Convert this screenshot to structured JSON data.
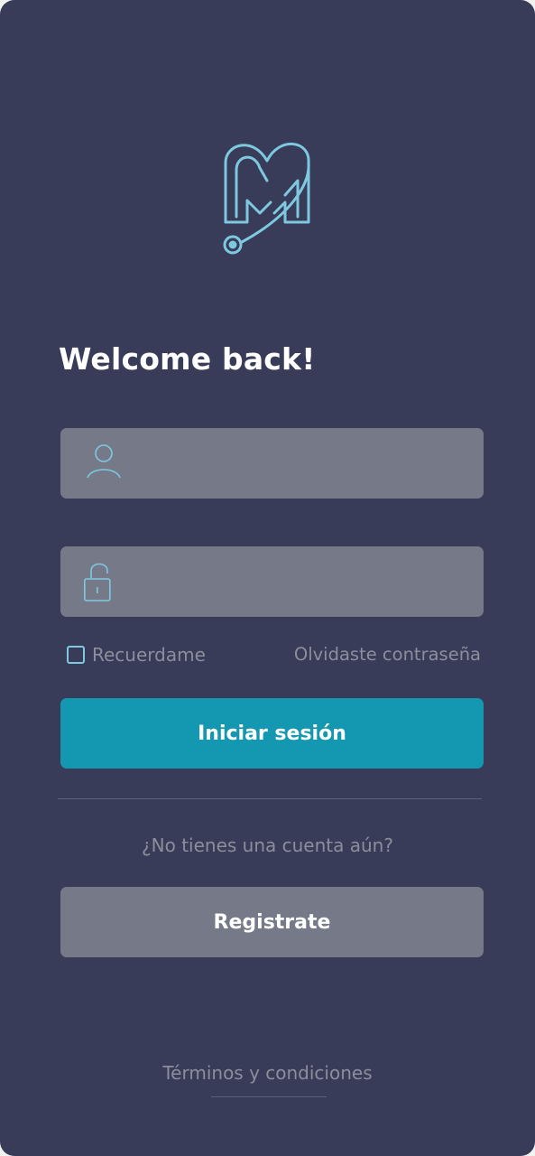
{
  "welcome_title": "Welcome back!",
  "username_field": {
    "value": "",
    "placeholder": ""
  },
  "password_field": {
    "value": "",
    "placeholder": ""
  },
  "remember_label": "Recuerdame",
  "remember_checked": false,
  "forgot_label": "Olvidaste contraseña",
  "login_button": "Iniciar sesión",
  "no_account_text": "¿No tienes una cuenta aún?",
  "register_button": "Registrate",
  "terms_link": "Términos y condiciones",
  "colors": {
    "background": "#383c58",
    "accent": "#1497b0",
    "field": "#767a88",
    "icon": "#7ec9e0",
    "muted_text": "#8a8e9d"
  },
  "icons": {
    "logo": "logo-icon",
    "user": "user-icon",
    "lock": "lock-icon"
  }
}
